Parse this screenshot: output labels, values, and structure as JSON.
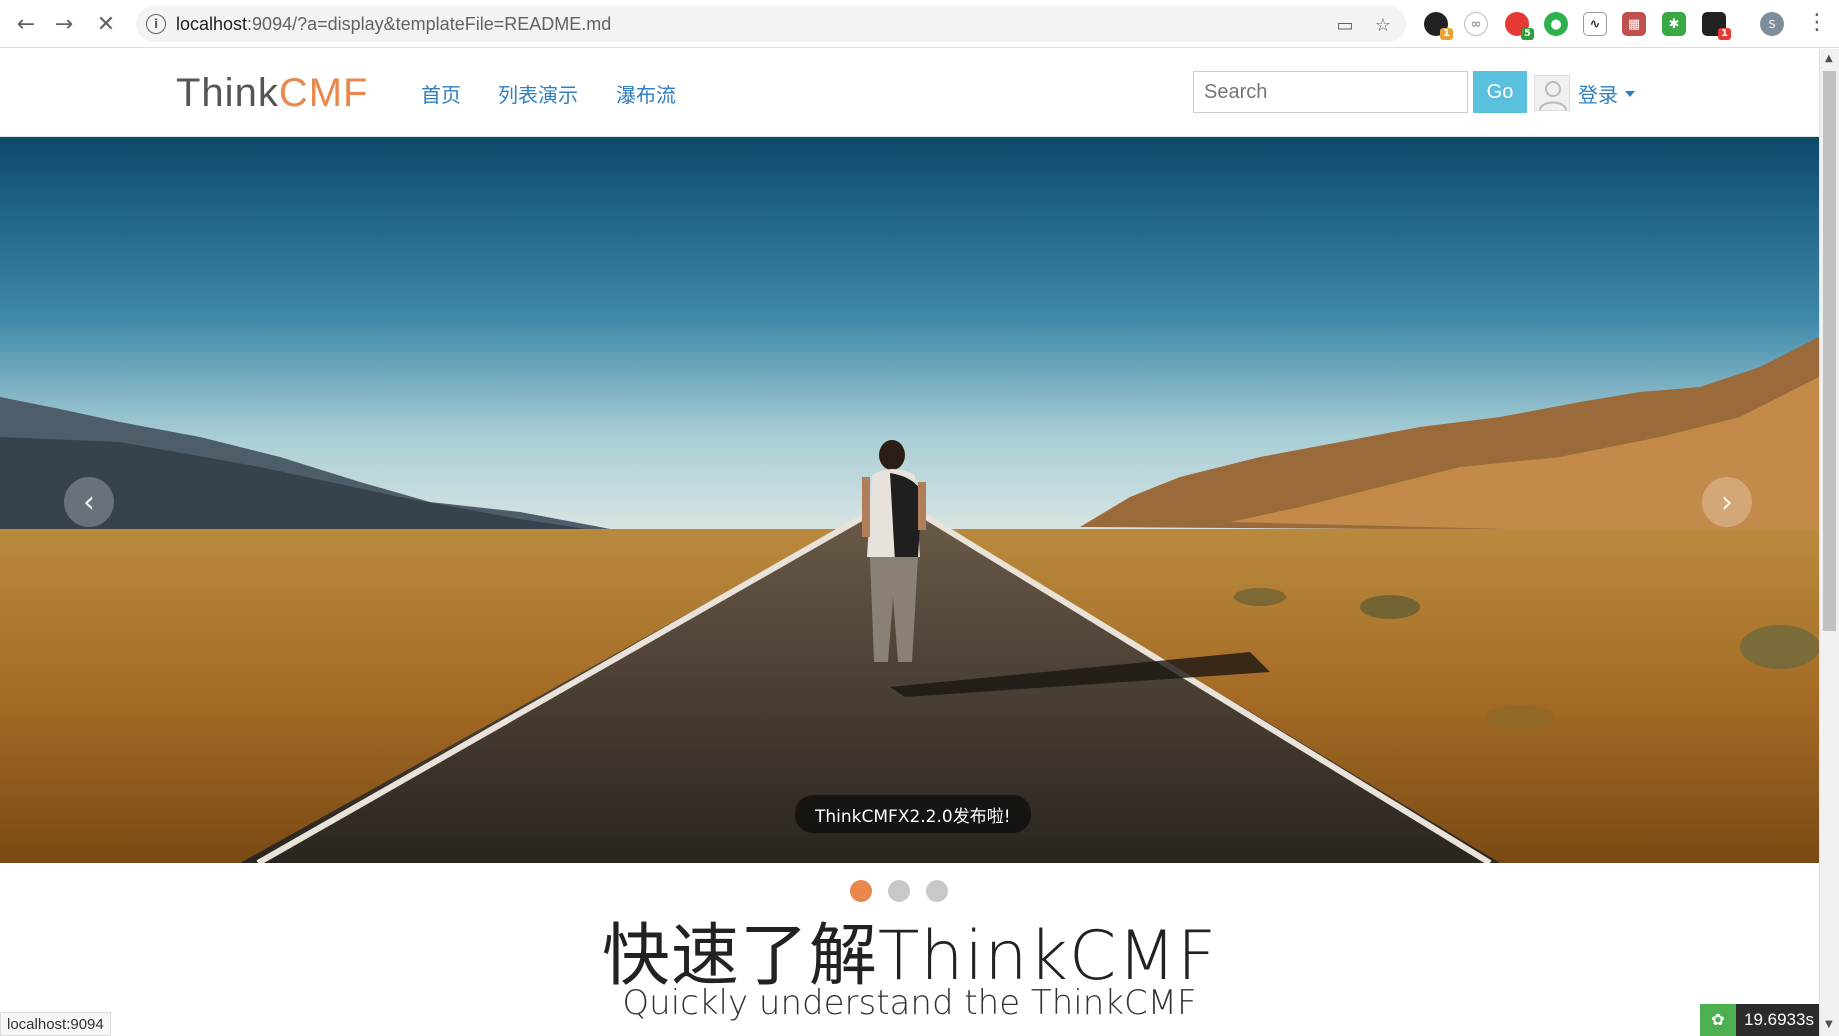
{
  "browser": {
    "url_host": "localhost",
    "url_rest": ":9094/?a=display&templateFile=README.md",
    "extension_badges": [
      "1",
      "5",
      "1"
    ],
    "profile_initial": "S"
  },
  "site": {
    "brand_left": "Think",
    "brand_right": "CMF",
    "nav": [
      "首页",
      "列表演示",
      "瀑布流"
    ],
    "search_placeholder": "Search",
    "go_label": "Go",
    "login_label": "登录"
  },
  "slider": {
    "caption": "ThinkCMFX2.2.0发布啦!",
    "slide_count": 3,
    "active_index": 0,
    "prev_glyph": "‹",
    "next_glyph": "›"
  },
  "content": {
    "title": "快速了解ThinkCMF",
    "subtitle": "Quickly understand the ThinkCMF"
  },
  "status_bar": {
    "url": "localhost:9094",
    "timer": "19.6933s"
  },
  "colors": {
    "accent": "#e9874c",
    "link": "#2f7fc0",
    "go_button": "#5bc0de"
  }
}
